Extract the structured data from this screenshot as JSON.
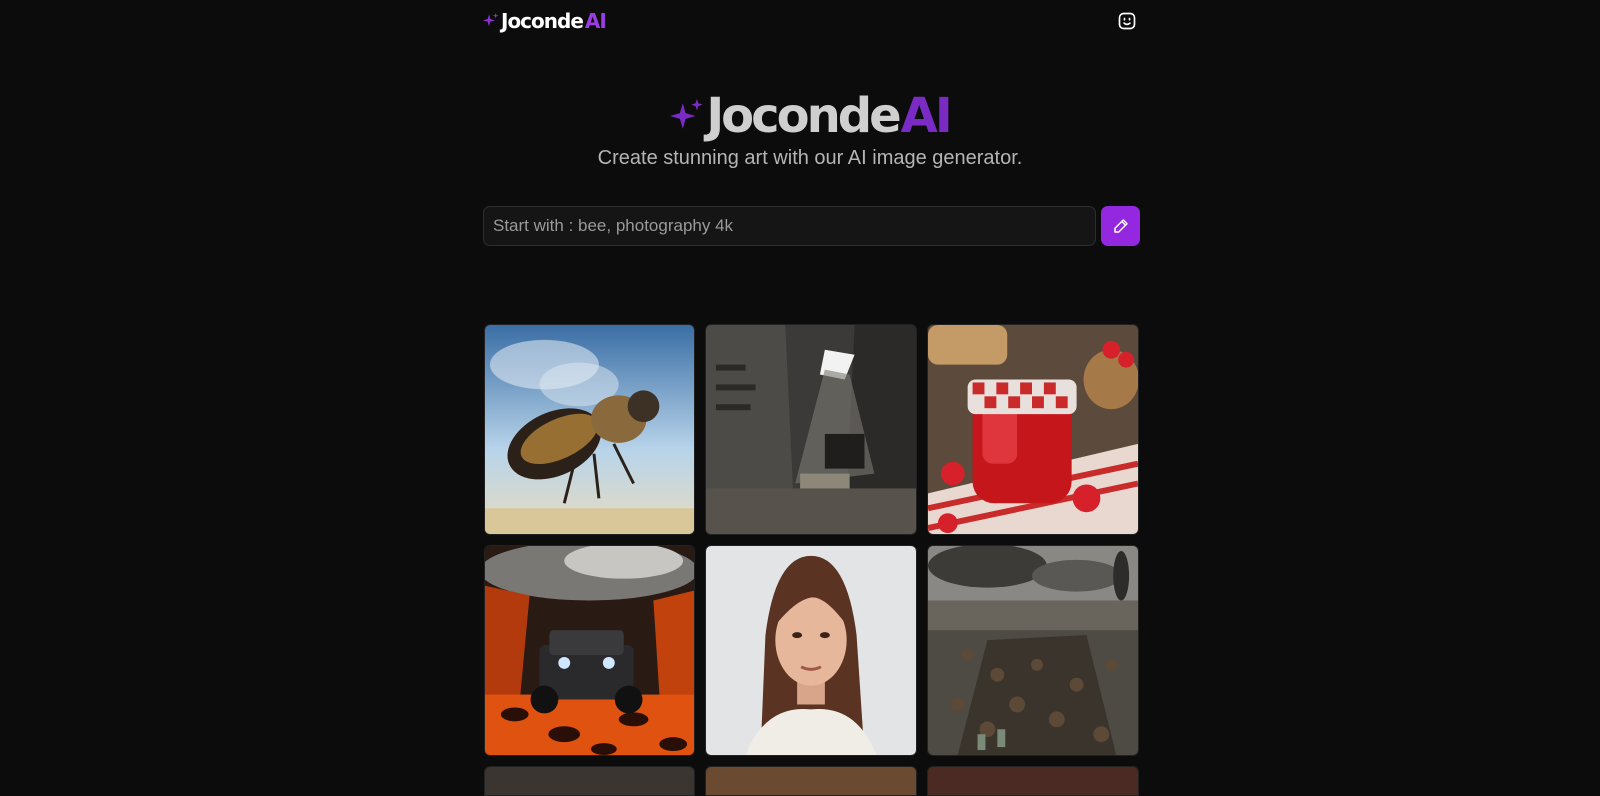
{
  "header": {
    "logo_word": "Joconde",
    "logo_accent": "AI",
    "profile_icon": "smile-icon"
  },
  "hero": {
    "title_word": "Joconde",
    "title_accent": "AI",
    "subtitle": "Create stunning art with our AI image generator."
  },
  "search": {
    "placeholder": "Start with : bee, photography 4k",
    "value": "",
    "button_icon": "pencil-icon"
  },
  "colors": {
    "accent": "#9428e0",
    "background": "#0c0c0c"
  },
  "gallery": {
    "items": [
      {
        "name": "bee",
        "icon": "bee-image"
      },
      {
        "name": "tomb",
        "icon": "tomb-image"
      },
      {
        "name": "jam",
        "icon": "strawberry-jam-image"
      },
      {
        "name": "jeep",
        "icon": "lava-jeep-image"
      },
      {
        "name": "woman",
        "icon": "portrait-image"
      },
      {
        "name": "soldiers",
        "icon": "battlefield-image"
      }
    ]
  }
}
